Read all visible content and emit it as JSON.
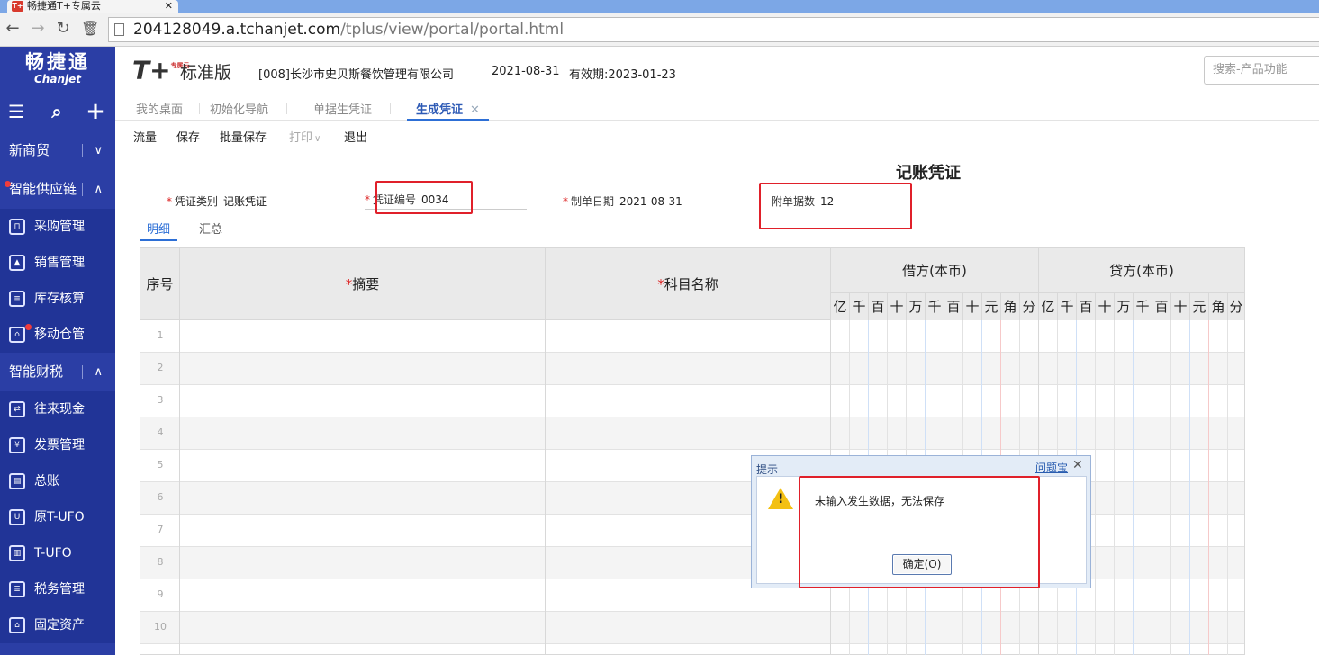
{
  "browser": {
    "tab_title": "畅捷通T+专属云",
    "favicon_text": "T+",
    "url_host": "204128049.a.tchanjet.com",
    "url_path": "/tplus/view/portal/portal.html"
  },
  "header": {
    "brand_cn": "畅捷通",
    "brand_en": "Chanjet",
    "product_logo": "T+",
    "product_logo_sub": "专属云",
    "edition": "标准版",
    "company": "[008]长沙市史贝斯餐饮管理有限公司",
    "date": "2021-08-31",
    "valid_until": "有效期:2023-01-23",
    "search_placeholder": "搜索-产品功能"
  },
  "sidebar": {
    "groups": [
      {
        "label": "新商贸",
        "chevron": "∨"
      },
      {
        "label": "智能供应链",
        "chevron": "∧"
      },
      {
        "label": "智能财税",
        "chevron": "∧"
      }
    ],
    "supply_items": [
      "采购管理",
      "销售管理",
      "库存核算",
      "移动仓管"
    ],
    "tax_items": [
      "往来现金",
      "发票管理",
      "总账",
      "原T-UFO",
      "T-UFO",
      "税务管理",
      "固定资产"
    ]
  },
  "doc_tabs": [
    {
      "label": "我的桌面"
    },
    {
      "label": "初始化导航"
    },
    {
      "label": "单据生凭证"
    },
    {
      "label": "生成凭证",
      "close": "✕"
    }
  ],
  "toolbar": {
    "flow": "流量",
    "save": "保存",
    "batch_save": "批量保存",
    "print": "打印",
    "print_caret": "∨",
    "exit": "退出"
  },
  "voucher": {
    "title": "记账凭证",
    "type_label": "凭证类别",
    "type_value": "记账凭证",
    "number_label": "凭证编号",
    "number_value": "0034",
    "date_label": "制单日期",
    "date_value": "2021-08-31",
    "attach_label": "附单据数",
    "attach_value": "12",
    "required_mark": "*"
  },
  "subtabs": {
    "detail": "明细",
    "summary": "汇总"
  },
  "grid": {
    "col_seq": "序号",
    "col_summary": "摘要",
    "col_account": "科目名称",
    "col_debit": "借方(本币)",
    "col_credit": "贷方(本币)",
    "digits": [
      "亿",
      "千",
      "百",
      "十",
      "万",
      "千",
      "百",
      "十",
      "元",
      "角",
      "分"
    ],
    "rows": [
      "1",
      "2",
      "3",
      "4",
      "5",
      "6",
      "7",
      "8",
      "9",
      "10"
    ]
  },
  "dialog": {
    "title": "提示",
    "help_link": "问题宝",
    "close": "✕",
    "message": "未输入发生数据，无法保存",
    "ok_button": "确定(O)",
    "icon_mark": "!"
  }
}
